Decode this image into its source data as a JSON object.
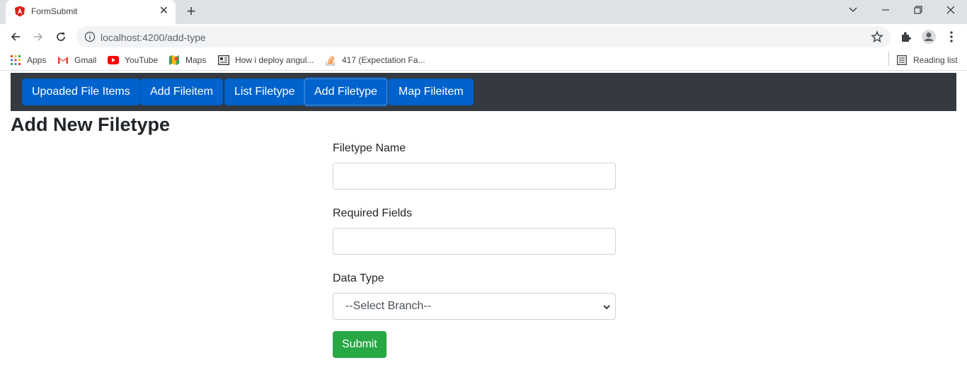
{
  "browser": {
    "tab": {
      "title": "FormSubmit"
    },
    "url": "localhost:4200/add-type",
    "bookmarks": [
      {
        "label": "Apps",
        "icon": "apps-grid-icon"
      },
      {
        "label": "Gmail",
        "icon": "gmail-icon"
      },
      {
        "label": "YouTube",
        "icon": "youtube-icon"
      },
      {
        "label": "Maps",
        "icon": "maps-icon"
      },
      {
        "label": "How i deploy angul...",
        "icon": "article-icon"
      },
      {
        "label": "417 (Expectation Fa...",
        "icon": "stack-overflow-icon"
      }
    ],
    "reading_list": "Reading list"
  },
  "app_nav": {
    "items": [
      {
        "label": "Upoaded File Items",
        "active": false
      },
      {
        "label": "Add Fileitem",
        "active": false
      },
      {
        "label": "List Filetype",
        "active": false
      },
      {
        "label": "Add Filetype",
        "active": true
      },
      {
        "label": "Map Fileitem",
        "active": false
      }
    ]
  },
  "page": {
    "title": "Add New Filetype"
  },
  "form": {
    "filetype_name": {
      "label": "Filetype Name",
      "value": ""
    },
    "required_fields": {
      "label": "Required Fields",
      "value": ""
    },
    "data_type": {
      "label": "Data Type",
      "selected": "--Select Branch--"
    },
    "submit_label": "Submit"
  },
  "colors": {
    "nav_bg": "#343a40",
    "primary": "#0062cc",
    "success": "#28a745",
    "chrome_tabstrip": "#dee1e6"
  }
}
